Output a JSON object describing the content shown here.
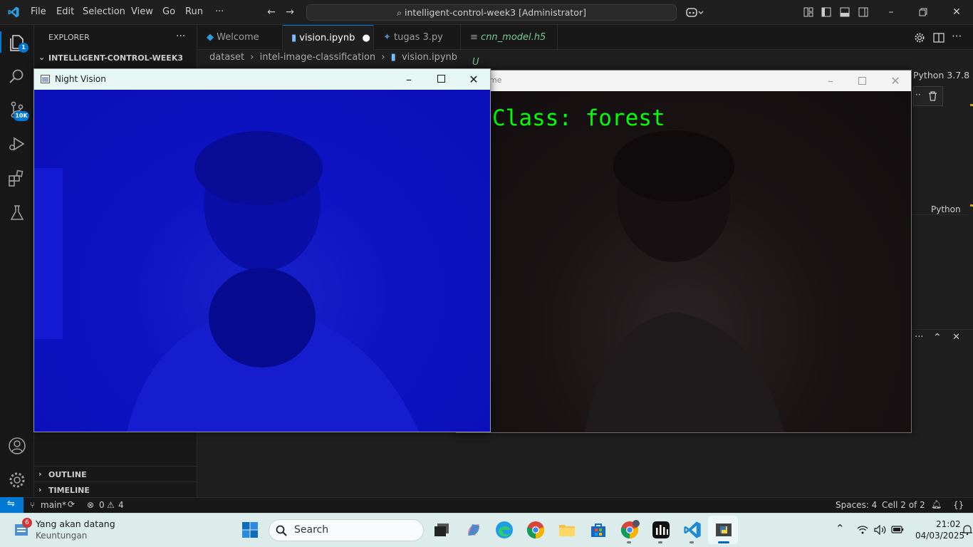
{
  "titlebar": {
    "menus": [
      "File",
      "Edit",
      "Selection",
      "View",
      "Go",
      "Run",
      "···"
    ],
    "search_text": "intelligent-control-week3 [Administrator]"
  },
  "activitybar": {
    "explorer_badge": "1",
    "scm_badge": "10K"
  },
  "sidebar": {
    "title": "EXPLORER",
    "menu": "···",
    "workspace": "INTELLIGENT-CONTROL-WEEK3",
    "outline": "OUTLINE",
    "timeline": "TIMELINE"
  },
  "tabs": [
    {
      "label": "Welcome",
      "icon": "vscode-icon"
    },
    {
      "label": "vision.ipynb",
      "icon": "notebook-icon",
      "dirty": true
    },
    {
      "label": "tugas 3.py",
      "icon": "python-icon"
    },
    {
      "label": "cnn_model.h5",
      "suffix": "U",
      "icon": "file-icon"
    }
  ],
  "breadcrumb": [
    "dataset",
    "intel-image-classification",
    "vision.ipynb"
  ],
  "editor": {
    "kernel": "Python 3.7.8",
    "cell_lang": "Python"
  },
  "windows": {
    "night_vision_title": "Night Vision",
    "frame_title_fragment": "me",
    "overlay_text": "Class: forest"
  },
  "statusbar": {
    "branch": "main*",
    "errors": "0",
    "warnings": "4",
    "spaces": "Spaces: 4",
    "cell": "Cell 2 of 2"
  },
  "taskbar": {
    "weather_badge": "6",
    "weather_title": "Yang akan datang",
    "weather_sub": "Keuntungan",
    "search_placeholder": "Search",
    "time": "21:02",
    "date": "04/03/2025"
  },
  "colors": {
    "accent": "#0078d4",
    "overlay_text": "#00ff00",
    "night_vision_tint": "#0f15c6"
  }
}
